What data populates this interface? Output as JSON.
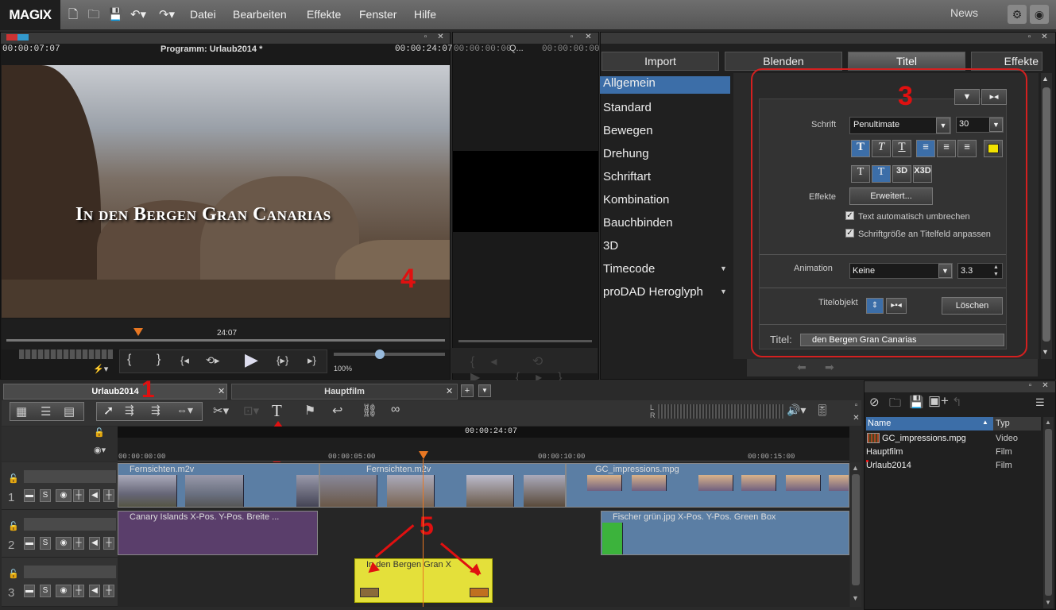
{
  "app": {
    "logo": "MAGIX"
  },
  "menu": {
    "items": [
      "Datei",
      "Bearbeiten",
      "Effekte",
      "Fenster",
      "Hilfe"
    ],
    "news": "News"
  },
  "preview": {
    "time_left": "00:00:07:07",
    "title": "Programm: Urlaub2014 *",
    "time_right": "00:00:24:07",
    "overlay_text": "In den Bergen Gran Canarias",
    "scrub_time": "24:07",
    "zoom": "100%",
    "transport": {
      "mark_in": "{",
      "mark_out": "}",
      "prev": "{◂",
      "loop": "⟲▸",
      "play": "▶",
      "mid": "{▸}",
      "next": "▸}"
    }
  },
  "preview2": {
    "time_left": "00:00:00:00",
    "q": "Q...",
    "time_right": "00:00:00:00"
  },
  "annotations": {
    "one": "1",
    "two": "2",
    "three": "3",
    "four": "4",
    "five": "5"
  },
  "media_tabs": [
    "Import",
    "Blenden",
    "Titel",
    "Effekte"
  ],
  "title_nav": [
    "Allgemein",
    "Standard",
    "Bewegen",
    "Drehung",
    "Schriftart",
    "Kombination",
    "Bauchbinden",
    "3D",
    "Timecode",
    "proDAD Heroglyph"
  ],
  "title_editor": {
    "schrift_label": "Schrift",
    "font": "Penultimate",
    "size": "30",
    "effekte_label": "Effekte",
    "erweitert_button": "Erweitert...",
    "wrap_label": "Text automatisch umbrechen",
    "fit_label": "Schriftgröße an Titelfeld anpassen",
    "animation_label": "Animation",
    "animation_value": "Keine",
    "animation_duration": "3.3",
    "titelobjekt_label": "Titelobjekt",
    "loeschen_button": "Löschen",
    "titel_label": "Titel:",
    "titel_value": "den Bergen Gran Canarias",
    "format_buttons": [
      "T",
      "T",
      "T"
    ],
    "style_buttons": [
      "T",
      "T",
      "3D",
      "X3D"
    ],
    "highlight_color": "#f2e200"
  },
  "timeline": {
    "tabs": [
      "Urlaub2014",
      "Hauptfilm"
    ],
    "current_time": "00:00:24:07",
    "ruler": [
      "00:00:00:00",
      "00:00:05:00",
      "00:00:10:00",
      "00:00:15:00"
    ],
    "tracks": [
      {
        "number": "1",
        "s": "S"
      },
      {
        "number": "2",
        "s": "S"
      },
      {
        "number": "3",
        "s": "S"
      }
    ],
    "clips": {
      "fern1": "Fernsichten.m2v",
      "fern2": "Fernsichten.m2v",
      "gc": "GC_impressions.mpg",
      "canary": "Canary Islands   X-Pos.  Y-Pos.  Breite ...",
      "fischer": "Fischer grün.jpg   X-Pos.  Y-Pos.  Green Box",
      "title": "In den Bergen Gran    X"
    },
    "colors": {
      "video": "#5b7ea4",
      "purple": "#5a3e6b",
      "title": "#e4e03a"
    }
  },
  "project": {
    "columns": [
      "Name",
      "Typ"
    ],
    "rows": [
      {
        "name": "GC_impressions.mpg",
        "type": "Video"
      },
      {
        "name": "Hauptfilm",
        "type": "Film"
      },
      {
        "name": "Urlaub2014",
        "type": "Film"
      }
    ]
  }
}
